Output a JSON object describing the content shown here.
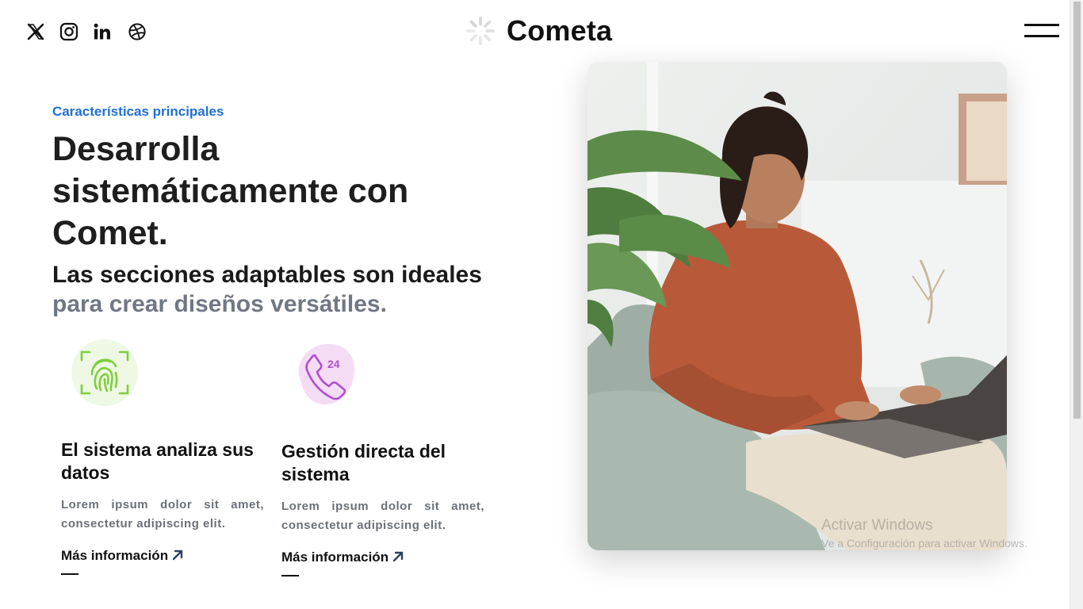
{
  "header": {
    "brand_name": "Cometa",
    "social": [
      "x-icon",
      "instagram-icon",
      "linkedin-icon",
      "dribbble-icon"
    ]
  },
  "section": {
    "eyebrow": "Características principales",
    "headline": "Desarrolla sistemáticamente con Comet.",
    "subhead_strong": "Las secciones adaptables son ideales",
    "subhead_muted": "para crear diseños versátiles."
  },
  "features": [
    {
      "icon": "fingerprint-icon",
      "title": "El sistema analiza sus datos",
      "text": "Lorem ipsum dolor sit amet, consectetur adipiscing elit.",
      "link": "Más información"
    },
    {
      "icon": "phone-24-icon",
      "title": "Gestión directa del sistema",
      "text": "Lorem ipsum dolor sit amet, consectetur adipiscing elit.",
      "link": "Más información"
    }
  ],
  "watermark": {
    "line1": "Activar Windows",
    "line2": "Ve a Configuración para activar Windows."
  },
  "colors": {
    "accent": "#1f6fd6",
    "muted": "#707784",
    "fingerprint_green": "#7fcf3a",
    "phone_purple": "#b04fd0"
  }
}
